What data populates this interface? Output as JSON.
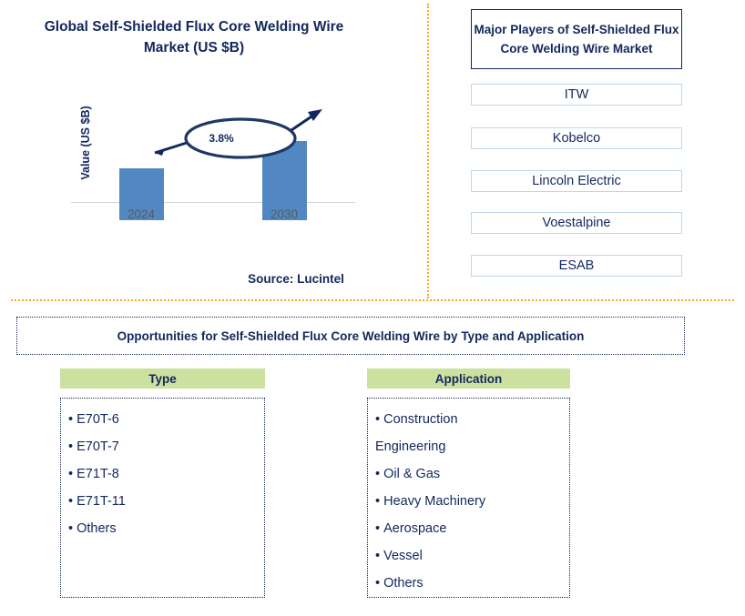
{
  "chart_panel": {
    "title": "Global Self-Shielded Flux Core Welding Wire Market (US $B)",
    "title_line1": "Global Self-Shielded Flux Core Welding Wire",
    "title_line2": "Market (US $B)",
    "y_axis_label": "Value (US $B)",
    "cagr_label": "3.8%",
    "source": "Source: Lucintel"
  },
  "chart_data": {
    "type": "bar",
    "title": "Global Self-Shielded Flux Core Welding Wire Market (US $B)",
    "categories": [
      "2024",
      "2030"
    ],
    "values": [
      1.0,
      1.53
    ],
    "xlabel": "",
    "ylabel": "Value (US $B)",
    "ylim": [
      0,
      1.75
    ],
    "grid": false,
    "legend": "none",
    "annotations": [
      {
        "text": "3.8%",
        "type": "cagr-callout",
        "from": "2024",
        "to": "2030"
      }
    ],
    "bar_color": "#5288c1",
    "tick_labels": [
      "2024",
      "2030"
    ]
  },
  "players": {
    "header": "Major Players of Self-Shielded Flux Core Welding Wire Market",
    "items": [
      {
        "label": "ITW"
      },
      {
        "label": "Kobelco"
      },
      {
        "label": "Lincoln Electric"
      },
      {
        "label": "Voestalpine"
      },
      {
        "label": "ESAB"
      }
    ]
  },
  "opportunities": {
    "title": "Opportunities for Self-Shielded Flux Core Welding Wire by Type and Application",
    "columns": [
      {
        "header": "Type",
        "items": [
          {
            "text": "E70T-6",
            "bullet": true
          },
          {
            "text": "E70T-7",
            "bullet": true
          },
          {
            "text": "E71T-8",
            "bullet": true
          },
          {
            "text": "E71T-11",
            "bullet": true
          },
          {
            "text": "Others",
            "bullet": true
          }
        ]
      },
      {
        "header": "Application",
        "items": [
          {
            "text": "Construction",
            "bullet": true
          },
          {
            "text": "Engineering",
            "bullet": false
          },
          {
            "text": "Oil & Gas",
            "bullet": true
          },
          {
            "text": "Heavy Machinery",
            "bullet": true
          },
          {
            "text": "Aerospace",
            "bullet": true
          },
          {
            "text": "Vessel",
            "bullet": true
          },
          {
            "text": "Others",
            "bullet": true
          }
        ]
      }
    ]
  },
  "colors": {
    "navy": "#12275c",
    "bar_blue": "#5288c1",
    "green_header": "#cce1a0",
    "orange_divider": "#f5a623",
    "light_blue_border": "#bdd7ee",
    "tick_gray": "#595959"
  }
}
